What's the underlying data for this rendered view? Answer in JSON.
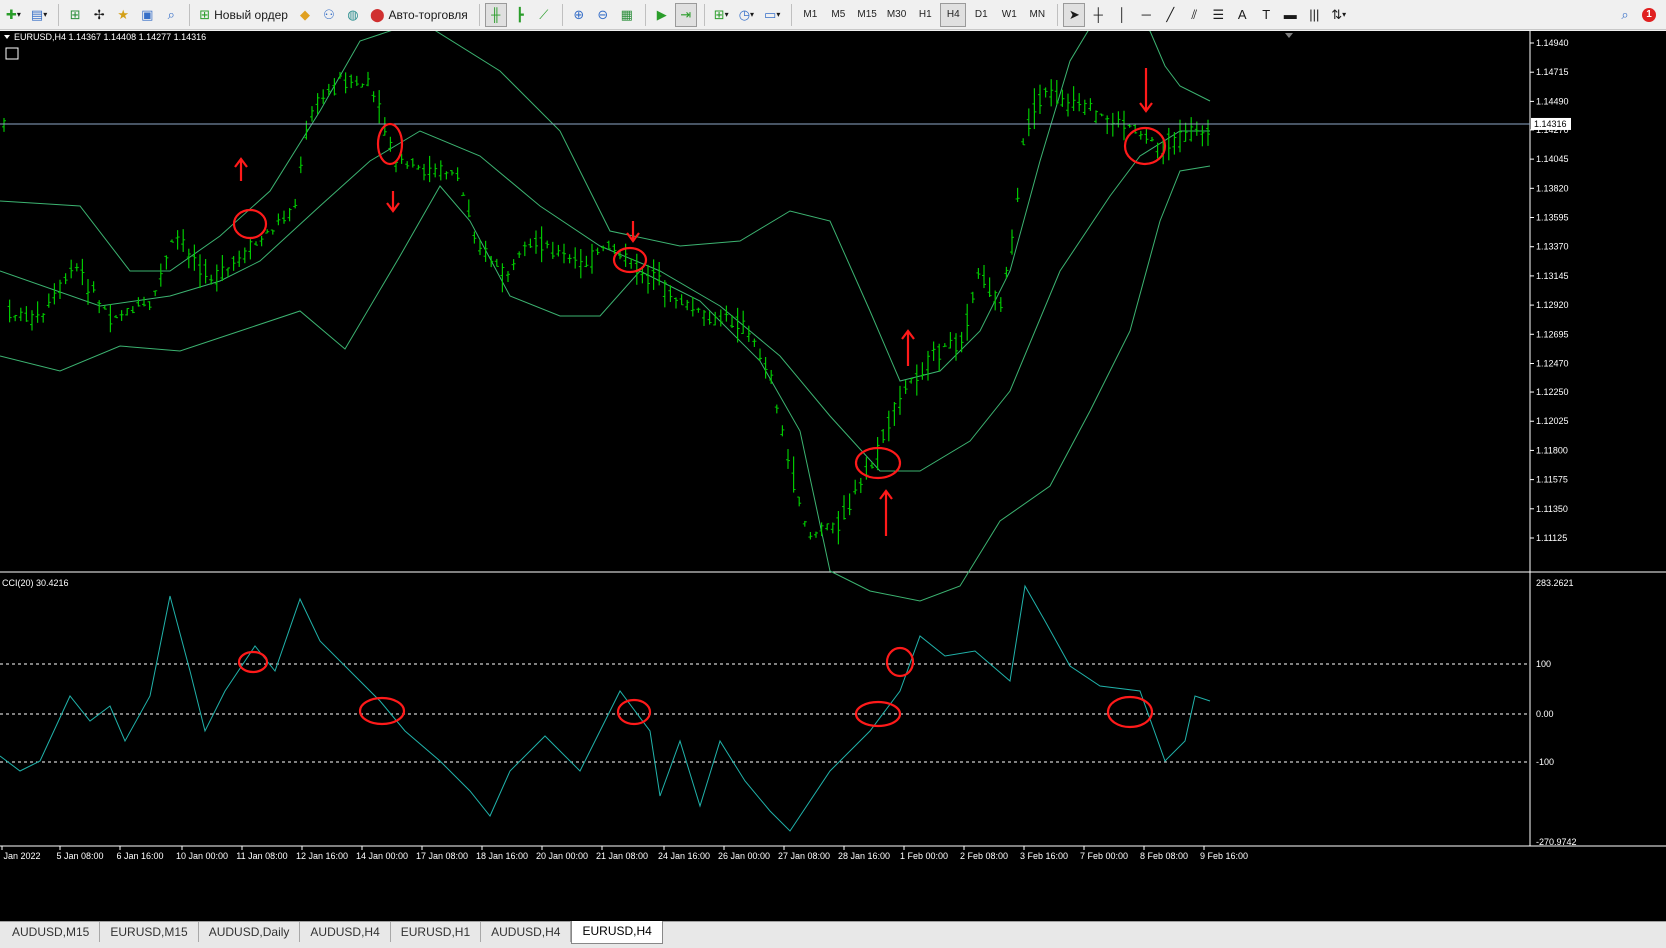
{
  "toolbar": {
    "new_order_label": "Новый ордер",
    "autotrading_label": "Авто-торговля",
    "timeframes": [
      "M1",
      "M5",
      "M15",
      "M30",
      "H1",
      "H4",
      "D1",
      "W1",
      "MN"
    ],
    "active_timeframe": "H4",
    "notifications_count": "1"
  },
  "chart": {
    "info_text": "EURUSD,H4  1.14367 1.14408 1.14277 1.14316",
    "current_price_label": "1.14316",
    "price_scale": [
      "1.14940",
      "1.14715",
      "1.14490",
      "1.14270",
      "1.14045",
      "1.13820",
      "1.13595",
      "1.13370",
      "1.13145",
      "1.12920",
      "1.12695",
      "1.12470",
      "1.12250",
      "1.12025",
      "1.11800",
      "1.11575",
      "1.11350",
      "1.11125"
    ],
    "cci_label": "CCI(20) 30.4216",
    "cci_scale": [
      "283.2621",
      "100",
      "0.00",
      "-100",
      "-270.9742"
    ],
    "time_labels": [
      "Jan 2022",
      "5 Jan 08:00",
      "6 Jan 16:00",
      "10 Jan 00:00",
      "11 Jan 08:00",
      "12 Jan 16:00",
      "14 Jan 00:00",
      "17 Jan 08:00",
      "18 Jan 16:00",
      "20 Jan 00:00",
      "21 Jan 08:00",
      "24 Jan 16:00",
      "26 Jan 00:00",
      "27 Jan 08:00",
      "28 Jan 16:00",
      "1 Feb 00:00",
      "2 Feb 08:00",
      "3 Feb 16:00",
      "7 Feb 00:00",
      "8 Feb 08:00",
      "9 Feb 16:00"
    ],
    "colors": {
      "bars": "#00c800",
      "bands": "#3cb371",
      "cci": "#20b2aa",
      "marks": "#ff1a1a",
      "grid": "#ffffff",
      "bg": "#000000"
    }
  },
  "tabs": [
    "AUDUSD,M15",
    "EURUSD,M15",
    "AUDUSD,Daily",
    "AUDUSD,H4",
    "EURUSD,H1",
    "AUDUSD,H4",
    "EURUSD,H4"
  ],
  "active_tab": "EURUSD,H4"
}
